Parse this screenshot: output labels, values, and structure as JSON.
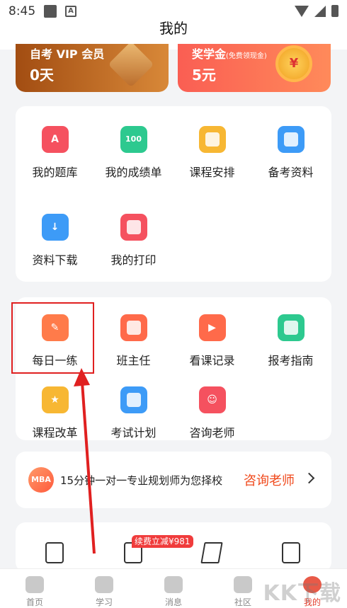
{
  "status": {
    "time": "8:45",
    "a_icon": "A"
  },
  "title": "我的",
  "banners": {
    "vip": {
      "title": "自考 VIP 会员",
      "value": "0天"
    },
    "scholarship": {
      "title": "奖学金",
      "subtitle": "(免费领现金)",
      "value": "5元",
      "badge": "¥"
    }
  },
  "grid1": [
    {
      "label": "我的题库",
      "icon": "question-bank-icon",
      "glyph": "A",
      "color": "#f5515f"
    },
    {
      "label": "我的成绩单",
      "icon": "score-sheet-icon",
      "glyph": "100",
      "color": "#2dc98f"
    },
    {
      "label": "课程安排",
      "icon": "calendar-icon",
      "glyph": "",
      "color": "#f7b733"
    },
    {
      "label": "备考资料",
      "icon": "materials-icon",
      "glyph": "",
      "color": "#3d9bf7"
    },
    {
      "label": "资料下载",
      "icon": "download-icon",
      "glyph": "↓",
      "color": "#3d9bf7"
    },
    {
      "label": "我的打印",
      "icon": "printer-icon",
      "glyph": "",
      "color": "#f5515f"
    }
  ],
  "grid2": [
    {
      "label": "每日一练",
      "icon": "daily-practice-icon",
      "glyph": "✎",
      "color": "#ff7b4a"
    },
    {
      "label": "班主任",
      "icon": "teacher-icon",
      "glyph": "",
      "color": "#ff6a4a"
    },
    {
      "label": "看课记录",
      "icon": "play-record-icon",
      "glyph": "▶",
      "color": "#ff6a4a"
    },
    {
      "label": "报考指南",
      "icon": "guide-icon",
      "glyph": "",
      "color": "#2dc98f"
    },
    {
      "label": "课程改革",
      "icon": "badge-icon",
      "glyph": "★",
      "color": "#f7b733"
    },
    {
      "label": "考试计划",
      "icon": "exam-plan-icon",
      "glyph": "",
      "color": "#3d9bf7"
    },
    {
      "label": "咨询老师",
      "icon": "consult-icon",
      "glyph": "☺",
      "color": "#f5515f"
    }
  ],
  "consult": {
    "badge": "MBA",
    "text": "15分钟一对一专业规划师为您择校",
    "link": "咨询老师"
  },
  "promo": "续费立减¥981",
  "tabs": [
    {
      "label": "首页",
      "icon": "home-icon"
    },
    {
      "label": "学习",
      "icon": "study-icon"
    },
    {
      "label": "消息",
      "icon": "message-icon"
    },
    {
      "label": "社区",
      "icon": "community-icon"
    },
    {
      "label": "我的",
      "icon": "profile-icon",
      "active": true
    }
  ],
  "watermark": "KK下载"
}
